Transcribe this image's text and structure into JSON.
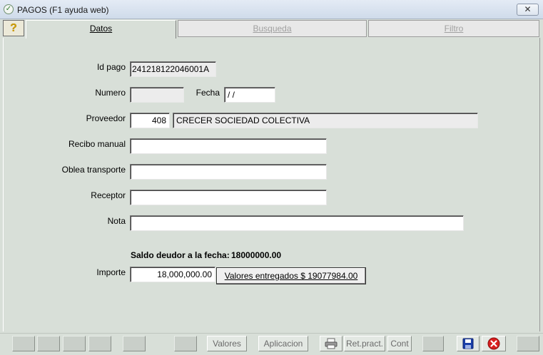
{
  "window": {
    "title": "PAGOS (F1 ayuda web)",
    "close_glyph": "✕"
  },
  "tabs": {
    "help_glyph": "?",
    "items": [
      {
        "label": "Datos",
        "active": true
      },
      {
        "label": "Busqueda",
        "active": false
      },
      {
        "label": "Filtro",
        "active": false
      }
    ]
  },
  "form": {
    "id_pago_label": "Id pago",
    "id_pago_value": "241218122046001A",
    "numero_label": "Numero",
    "numero_value": "",
    "fecha_label": "Fecha",
    "fecha_value": " / /",
    "proveedor_label": "Proveedor",
    "proveedor_code": "408",
    "proveedor_name": "CRECER SOCIEDAD COLECTIVA",
    "recibo_label": "Recibo manual",
    "recibo_value": "",
    "oblea_label": "Oblea transporte",
    "oblea_value": "",
    "receptor_label": "Receptor",
    "receptor_value": "",
    "nota_label": "Nota",
    "nota_value": "",
    "saldo_label": "Saldo deudor a la fecha:",
    "saldo_value": "18000000.00",
    "importe_label": "Importe",
    "importe_value": "18,000,000.00",
    "valores_button": "Valores entregados $ 19077984.00"
  },
  "toolbar": {
    "valores": "Valores",
    "aplicacion": "Aplicacion",
    "ret_pract": "Ret.pract.",
    "cont": "Cont",
    "icons": [
      "printer-icon",
      "save-icon",
      "cancel-icon"
    ]
  },
  "colors": {
    "background": "#d8dfd8",
    "titlebar": "#d5e0ee",
    "cancel_red": "#d81e1e",
    "save_blue": "#1a3fa8"
  }
}
